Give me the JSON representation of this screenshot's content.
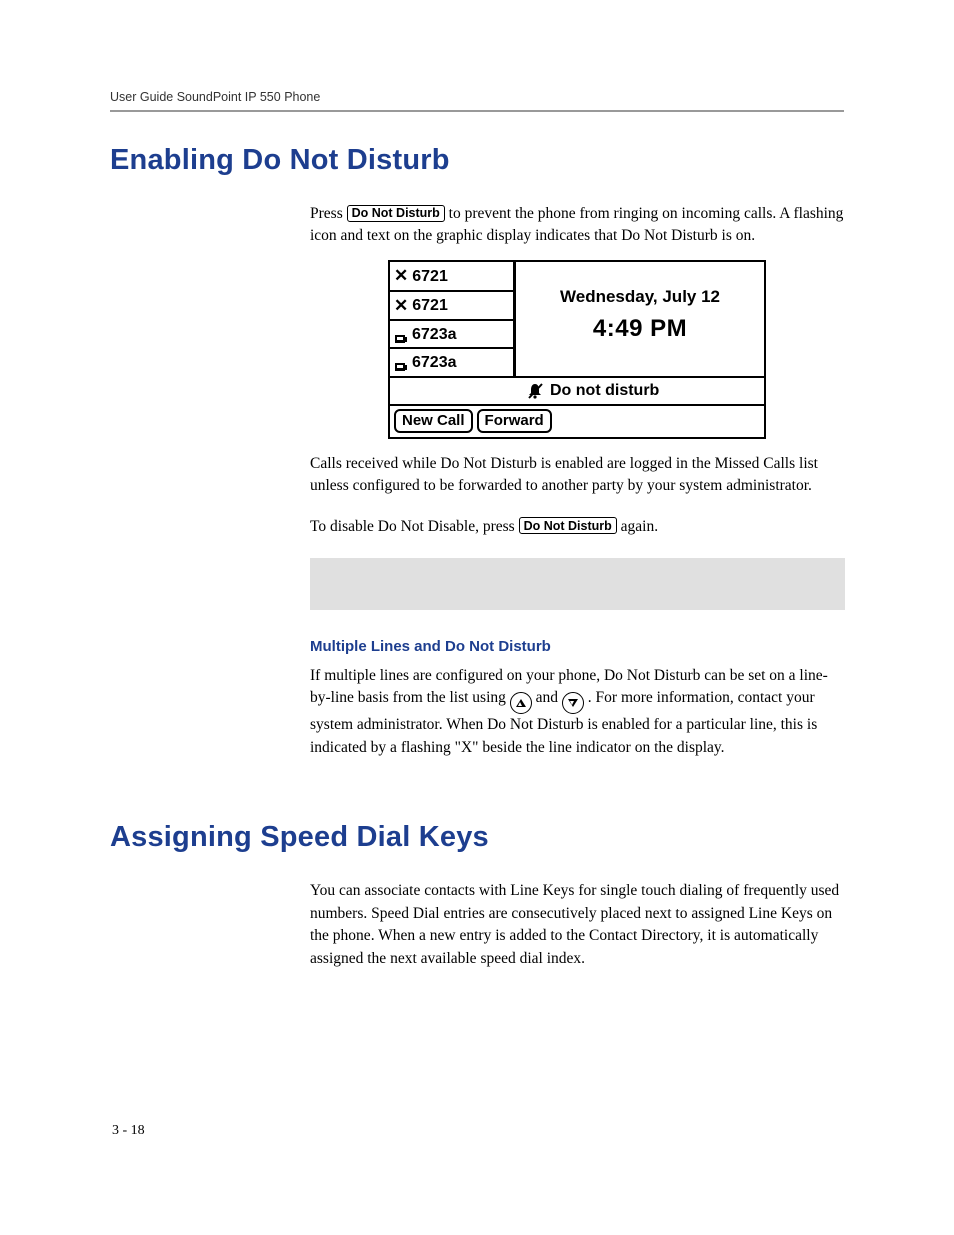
{
  "header": {
    "running": "User Guide SoundPoint IP 550 Phone"
  },
  "section1": {
    "title": "Enabling Do Not Disturb",
    "para1_a": "Press ",
    "btn_dnd": "Do Not Disturb",
    "para1_b": " to prevent the phone from ringing on incoming calls. A flashing icon and text on the graphic display indicates that Do Not Disturb is on.",
    "lcd": {
      "lines": [
        "6721",
        "6721",
        "6723a",
        "6723a"
      ],
      "date": "Wednesday, July 12",
      "time": "4:49 PM",
      "dnd_text": "Do not disturb",
      "softkeys": [
        "New Call",
        "Forward"
      ]
    },
    "para2": "Calls received while Do Not Disturb is enabled are logged in the Missed Calls list unless configured to be forwarded to another party by your system administrator.",
    "para3_a": "To disable Do Not Disable, press ",
    "para3_b": " again.",
    "sub_title": "Multiple Lines and Do Not Disturb",
    "para4_a": "If multiple lines are configured on your phone, Do Not Disturb can be set on a line-by-line basis from the list using ",
    "para4_b": " and ",
    "para4_c": ". For more information, contact your system administrator. When Do Not Disturb is enabled for a particular line, this is indicated by a flashing \"X\" beside the line indicator on the display."
  },
  "section2": {
    "title": "Assigning Speed Dial Keys",
    "para1": "You can associate contacts with Line Keys for single touch dialing of frequently used numbers. Speed Dial entries are consecutively placed next to assigned Line Keys on the phone. When a new entry is added to the Contact Directory, it is automatically assigned the next available speed dial index."
  },
  "footer": {
    "page_number": "3 - 18"
  }
}
